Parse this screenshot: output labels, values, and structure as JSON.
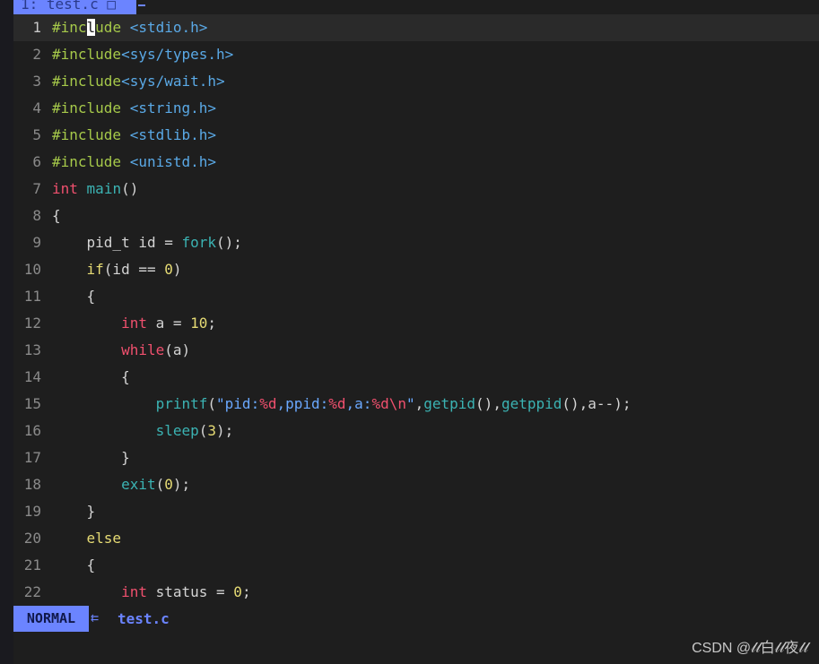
{
  "tabline": {
    "tab_label": "1: test.c □",
    "separator": "–"
  },
  "editor": {
    "lines": [
      {
        "num": "1",
        "tokens": [
          [
            "pp",
            "#inc"
          ],
          [
            "cursor",
            "l"
          ],
          [
            "pp",
            "ude"
          ],
          [
            "plain",
            " "
          ],
          [
            "hdr",
            "<stdio.h>"
          ]
        ]
      },
      {
        "num": "2",
        "tokens": [
          [
            "pp",
            "#include"
          ],
          [
            "hdr",
            "<sys/types.h>"
          ]
        ]
      },
      {
        "num": "3",
        "tokens": [
          [
            "pp",
            "#include"
          ],
          [
            "hdr",
            "<sys/wait.h>"
          ]
        ]
      },
      {
        "num": "4",
        "tokens": [
          [
            "pp",
            "#include"
          ],
          [
            "plain",
            " "
          ],
          [
            "hdr",
            "<string.h>"
          ]
        ]
      },
      {
        "num": "5",
        "tokens": [
          [
            "pp",
            "#include"
          ],
          [
            "plain",
            " "
          ],
          [
            "hdr",
            "<stdlib.h>"
          ]
        ]
      },
      {
        "num": "6",
        "tokens": [
          [
            "pp",
            "#include"
          ],
          [
            "plain",
            " "
          ],
          [
            "hdr",
            "<unistd.h>"
          ]
        ]
      },
      {
        "num": "7",
        "tokens": [
          [
            "kw",
            "int"
          ],
          [
            "plain",
            " "
          ],
          [
            "fn",
            "main"
          ],
          [
            "plain",
            "()"
          ]
        ]
      },
      {
        "num": "8",
        "tokens": [
          [
            "plain",
            "{"
          ]
        ]
      },
      {
        "num": "9",
        "tokens": [
          [
            "plain",
            "    pid_t id = "
          ],
          [
            "fn",
            "fork"
          ],
          [
            "plain",
            "();"
          ]
        ]
      },
      {
        "num": "10",
        "tokens": [
          [
            "plain",
            "    "
          ],
          [
            "ctl",
            "if"
          ],
          [
            "plain",
            "(id == "
          ],
          [
            "num",
            "0"
          ],
          [
            "plain",
            ")"
          ]
        ]
      },
      {
        "num": "11",
        "tokens": [
          [
            "plain",
            "    {"
          ]
        ]
      },
      {
        "num": "12",
        "tokens": [
          [
            "plain",
            "        "
          ],
          [
            "kw",
            "int"
          ],
          [
            "plain",
            " a = "
          ],
          [
            "num",
            "10"
          ],
          [
            "plain",
            ";"
          ]
        ]
      },
      {
        "num": "13",
        "tokens": [
          [
            "plain",
            "        "
          ],
          [
            "kw",
            "while"
          ],
          [
            "plain",
            "(a)"
          ]
        ]
      },
      {
        "num": "14",
        "tokens": [
          [
            "plain",
            "        {"
          ]
        ]
      },
      {
        "num": "15",
        "tokens": [
          [
            "plain",
            "            "
          ],
          [
            "fn",
            "printf"
          ],
          [
            "plain",
            "("
          ],
          [
            "str",
            "\"pid:"
          ],
          [
            "esc",
            "%d"
          ],
          [
            "str",
            ",ppid:"
          ],
          [
            "esc",
            "%d"
          ],
          [
            "str",
            ",a:"
          ],
          [
            "esc",
            "%d\\n"
          ],
          [
            "str",
            "\""
          ],
          [
            "plain",
            ","
          ],
          [
            "fn",
            "getpid"
          ],
          [
            "plain",
            "(),"
          ],
          [
            "fn",
            "getppid"
          ],
          [
            "plain",
            "(),a--);"
          ]
        ]
      },
      {
        "num": "16",
        "tokens": [
          [
            "plain",
            "            "
          ],
          [
            "fn",
            "sleep"
          ],
          [
            "plain",
            "("
          ],
          [
            "num",
            "3"
          ],
          [
            "plain",
            ");"
          ]
        ]
      },
      {
        "num": "17",
        "tokens": [
          [
            "plain",
            "        }"
          ]
        ]
      },
      {
        "num": "18",
        "tokens": [
          [
            "plain",
            "        "
          ],
          [
            "fn",
            "exit"
          ],
          [
            "plain",
            "("
          ],
          [
            "num",
            "0"
          ],
          [
            "plain",
            ");"
          ]
        ]
      },
      {
        "num": "19",
        "tokens": [
          [
            "plain",
            "    }"
          ]
        ]
      },
      {
        "num": "20",
        "tokens": [
          [
            "plain",
            "    "
          ],
          [
            "ctl",
            "else"
          ]
        ]
      },
      {
        "num": "21",
        "tokens": [
          [
            "plain",
            "    {"
          ]
        ]
      },
      {
        "num": "22",
        "tokens": [
          [
            "plain",
            "        "
          ],
          [
            "kw",
            "int"
          ],
          [
            "plain",
            " status = "
          ],
          [
            "num",
            "0"
          ],
          [
            "plain",
            ";"
          ]
        ]
      }
    ]
  },
  "statusline": {
    "mode": "NORMAL",
    "arrow": "⇇",
    "filename": "test.c"
  },
  "watermark": "CSDN @𝓁𝓁白𝓁𝓁夜𝓁𝓁",
  "colors": {
    "background": "#1e1e1e",
    "accent": "#6b84ff",
    "preprocessor": "#a6c94a",
    "keyword": "#f0506e",
    "function": "#3bb3b3",
    "number": "#e6db74",
    "string": "#6aa8ff"
  }
}
